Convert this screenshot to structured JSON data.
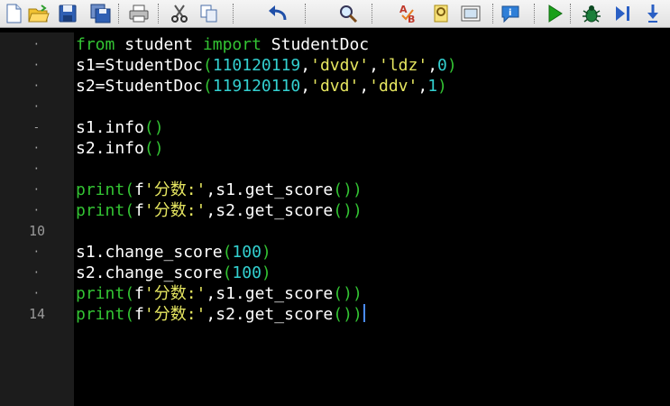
{
  "toolbar": {
    "buttons": [
      {
        "name": "new-file",
        "icon": "new-file-icon"
      },
      {
        "name": "open-folder",
        "icon": "open-folder-icon"
      },
      {
        "name": "save",
        "icon": "save-icon"
      },
      {
        "name": "save-all",
        "icon": "save-all-icon"
      },
      {
        "name": "print",
        "icon": "print-icon"
      },
      {
        "name": "cut",
        "icon": "scissors-icon"
      },
      {
        "name": "copy",
        "icon": "copy-icon"
      },
      {
        "name": "undo",
        "icon": "undo-arrow-icon"
      },
      {
        "name": "find",
        "icon": "magnifier-icon"
      },
      {
        "name": "spellcheck",
        "icon": "spellcheck-icon"
      },
      {
        "name": "bookmark",
        "icon": "bookmark-icon"
      },
      {
        "name": "snapshot",
        "icon": "snapshot-icon"
      },
      {
        "name": "help",
        "icon": "help-bubble-icon"
      },
      {
        "name": "run",
        "icon": "play-icon"
      },
      {
        "name": "debug",
        "icon": "bug-icon"
      },
      {
        "name": "step-over",
        "icon": "step-over-icon"
      },
      {
        "name": "step-into",
        "icon": "step-into-icon"
      }
    ]
  },
  "editor": {
    "line_numbers": [
      "·",
      "·",
      "·",
      "·",
      "-",
      "·",
      "·",
      "·",
      "·",
      "10",
      "·",
      "·",
      "·",
      "14"
    ],
    "lines": [
      [
        {
          "t": "from",
          "c": "kw"
        },
        {
          "t": " student ",
          "c": "id"
        },
        {
          "t": "import",
          "c": "kw"
        },
        {
          "t": " StudentDoc",
          "c": "id"
        }
      ],
      [
        {
          "t": "s1=StudentDoc",
          "c": "id"
        },
        {
          "t": "(",
          "c": "par"
        },
        {
          "t": "110120119",
          "c": "num"
        },
        {
          "t": ",",
          "c": "id"
        },
        {
          "t": "'dvdv'",
          "c": "str"
        },
        {
          "t": ",",
          "c": "id"
        },
        {
          "t": "'ldz'",
          "c": "str"
        },
        {
          "t": ",",
          "c": "id"
        },
        {
          "t": "0",
          "c": "num"
        },
        {
          "t": ")",
          "c": "par"
        }
      ],
      [
        {
          "t": "s2=StudentDoc",
          "c": "id"
        },
        {
          "t": "(",
          "c": "par"
        },
        {
          "t": "119120110",
          "c": "num"
        },
        {
          "t": ",",
          "c": "id"
        },
        {
          "t": "'dvd'",
          "c": "str"
        },
        {
          "t": ",",
          "c": "id"
        },
        {
          "t": "'ddv'",
          "c": "str"
        },
        {
          "t": ",",
          "c": "id"
        },
        {
          "t": "1",
          "c": "num"
        },
        {
          "t": ")",
          "c": "par"
        }
      ],
      [],
      [
        {
          "t": "s1.info",
          "c": "id"
        },
        {
          "t": "()",
          "c": "par"
        }
      ],
      [
        {
          "t": "s2.info",
          "c": "id"
        },
        {
          "t": "()",
          "c": "par"
        }
      ],
      [],
      [
        {
          "t": "print",
          "c": "kw"
        },
        {
          "t": "(",
          "c": "par"
        },
        {
          "t": "f",
          "c": "id"
        },
        {
          "t": "'分数:'",
          "c": "str"
        },
        {
          "t": ",s1.get_score",
          "c": "id"
        },
        {
          "t": "())",
          "c": "par"
        }
      ],
      [
        {
          "t": "print",
          "c": "kw"
        },
        {
          "t": "(",
          "c": "par"
        },
        {
          "t": "f",
          "c": "id"
        },
        {
          "t": "'分数:'",
          "c": "str"
        },
        {
          "t": ",s2.get_score",
          "c": "id"
        },
        {
          "t": "())",
          "c": "par"
        }
      ],
      [],
      [
        {
          "t": "s1.change_score",
          "c": "id"
        },
        {
          "t": "(",
          "c": "par"
        },
        {
          "t": "100",
          "c": "num"
        },
        {
          "t": ")",
          "c": "par"
        }
      ],
      [
        {
          "t": "s2.change_score",
          "c": "id"
        },
        {
          "t": "(",
          "c": "par"
        },
        {
          "t": "100",
          "c": "num"
        },
        {
          "t": ")",
          "c": "par"
        }
      ],
      [
        {
          "t": "print",
          "c": "kw"
        },
        {
          "t": "(",
          "c": "par"
        },
        {
          "t": "f",
          "c": "id"
        },
        {
          "t": "'分数:'",
          "c": "str"
        },
        {
          "t": ",s1.get_score",
          "c": "id"
        },
        {
          "t": "())",
          "c": "par"
        }
      ],
      [
        {
          "t": "print",
          "c": "kw"
        },
        {
          "t": "(",
          "c": "par"
        },
        {
          "t": "f",
          "c": "id"
        },
        {
          "t": "'分数:'",
          "c": "str"
        },
        {
          "t": ",s2.get_score",
          "c": "id"
        },
        {
          "t": "())",
          "c": "par"
        }
      ]
    ],
    "colors": {
      "keyword": "#33c333",
      "number": "#33d0d0",
      "string": "#e6e660",
      "text": "#ffffff",
      "background": "#000000",
      "gutter": "#1c1c1c",
      "caret": "#4a8cff"
    }
  }
}
